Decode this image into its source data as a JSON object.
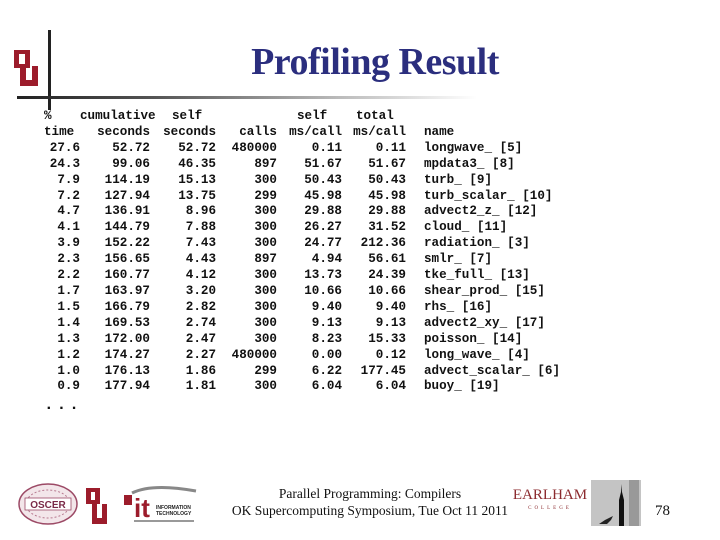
{
  "slide": {
    "title": "Profiling Result",
    "page_number": "78",
    "footer_line1": "Parallel Programming: Compilers",
    "footer_line2": "OK Supercomputing Symposium, Tue Oct 11 2011",
    "ellipsis": "...",
    "colors": {
      "title": "#2b2e7e",
      "ou_crimson": "#9c1c2b",
      "earlham": "#8b2a2e"
    }
  },
  "logos": {
    "oscer": "OSCER",
    "it_label1": "INFORMATION",
    "it_label2": "TECHNOLOGY",
    "earlham_name": "EARLHAM",
    "earlham_sub": "COLLEGE"
  },
  "profile": {
    "header1": [
      "%",
      "cumulative",
      "self",
      "",
      "self",
      "total",
      ""
    ],
    "header2": [
      "time",
      "seconds",
      "seconds",
      "calls",
      "ms/call",
      "ms/call",
      "name"
    ],
    "rows": [
      [
        "27.6",
        "52.72",
        "52.72",
        "480000",
        "0.11",
        "0.11",
        "longwave_ [5]"
      ],
      [
        "24.3",
        "99.06",
        "46.35",
        "897",
        "51.67",
        "51.67",
        "mpdata3_ [8]"
      ],
      [
        "7.9",
        "114.19",
        "15.13",
        "300",
        "50.43",
        "50.43",
        "turb_ [9]"
      ],
      [
        "7.2",
        "127.94",
        "13.75",
        "299",
        "45.98",
        "45.98",
        "turb_scalar_ [10]"
      ],
      [
        "4.7",
        "136.91",
        "8.96",
        "300",
        "29.88",
        "29.88",
        "advect2_z_ [12]"
      ],
      [
        "4.1",
        "144.79",
        "7.88",
        "300",
        "26.27",
        "31.52",
        "cloud_ [11]"
      ],
      [
        "3.9",
        "152.22",
        "7.43",
        "300",
        "24.77",
        "212.36",
        "radiation_ [3]"
      ],
      [
        "2.3",
        "156.65",
        "4.43",
        "897",
        "4.94",
        "56.61",
        "smlr_ [7]"
      ],
      [
        "2.2",
        "160.77",
        "4.12",
        "300",
        "13.73",
        "24.39",
        "tke_full_ [13]"
      ],
      [
        "1.7",
        "163.97",
        "3.20",
        "300",
        "10.66",
        "10.66",
        "shear_prod_ [15]"
      ],
      [
        "1.5",
        "166.79",
        "2.82",
        "300",
        "9.40",
        "9.40",
        "rhs_ [16]"
      ],
      [
        "1.4",
        "169.53",
        "2.74",
        "300",
        "9.13",
        "9.13",
        "advect2_xy_ [17]"
      ],
      [
        "1.3",
        "172.00",
        "2.47",
        "300",
        "8.23",
        "15.33",
        "poisson_ [14]"
      ],
      [
        "1.2",
        "174.27",
        "2.27",
        "480000",
        "0.00",
        "0.12",
        "long_wave_ [4]"
      ],
      [
        "1.0",
        "176.13",
        "1.86",
        "299",
        "6.22",
        "177.45",
        "advect_scalar_ [6]"
      ],
      [
        "0.9",
        "177.94",
        "1.81",
        "300",
        "6.04",
        "6.04",
        "buoy_ [19]"
      ]
    ]
  }
}
